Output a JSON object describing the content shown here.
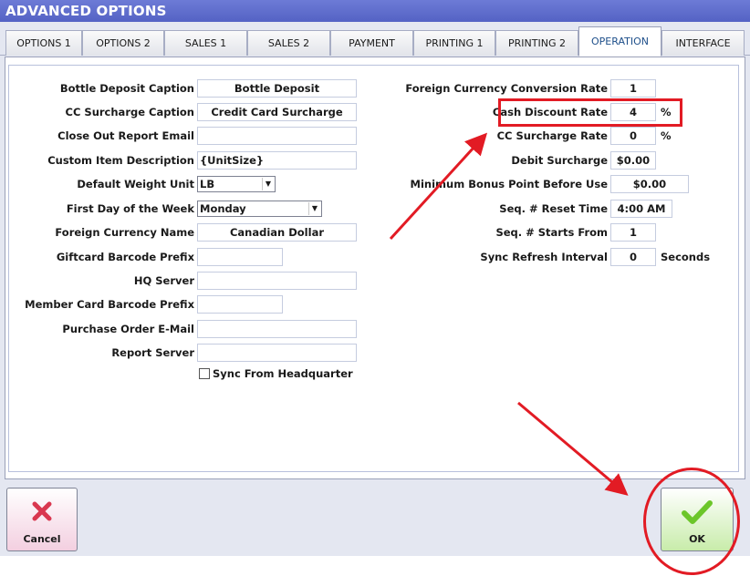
{
  "window": {
    "title": "ADVANCED OPTIONS"
  },
  "tabs": [
    {
      "label": "OPTIONS 1"
    },
    {
      "label": "OPTIONS 2"
    },
    {
      "label": "SALES 1"
    },
    {
      "label": "SALES 2"
    },
    {
      "label": "PAYMENT"
    },
    {
      "label": "PRINTING 1"
    },
    {
      "label": "PRINTING 2"
    },
    {
      "label": "OPERATION",
      "active": true
    },
    {
      "label": "INTERFACE"
    }
  ],
  "left_fields": {
    "bottle_deposit_caption": {
      "label": "Bottle Deposit Caption",
      "value": "Bottle Deposit"
    },
    "cc_surcharge_caption": {
      "label": "CC Surcharge Caption",
      "value": "Credit Card Surcharge"
    },
    "close_out_report_email": {
      "label": "Close Out Report Email",
      "value": ""
    },
    "custom_item_description": {
      "label": "Custom Item Description",
      "value": "{UnitSize}"
    },
    "default_weight_unit": {
      "label": "Default Weight Unit",
      "value": "LB"
    },
    "first_day_of_week": {
      "label": "First Day of the Week",
      "value": "Monday"
    },
    "foreign_currency_name": {
      "label": "Foreign Currency Name",
      "value": "Canadian Dollar"
    },
    "giftcard_barcode_prefix": {
      "label": "Giftcard Barcode Prefix",
      "value": ""
    },
    "hq_server": {
      "label": "HQ Server",
      "value": ""
    },
    "member_card_barcode_prefix": {
      "label": "Member Card Barcode Prefix",
      "value": ""
    },
    "purchase_order_email": {
      "label": "Purchase Order E-Mail",
      "value": ""
    },
    "report_server": {
      "label": "Report Server",
      "value": ""
    },
    "sync_from_headquarter": {
      "label": "Sync From Headquarter",
      "checked": false
    }
  },
  "right_fields": {
    "foreign_currency_conversion_rate": {
      "label": "Foreign Currency Conversion Rate",
      "value": "1"
    },
    "cash_discount_rate": {
      "label": "Cash Discount Rate",
      "value": "4",
      "suffix": "%"
    },
    "cc_surcharge_rate": {
      "label": "CC Surcharge Rate",
      "value": "0",
      "suffix": "%"
    },
    "debit_surcharge": {
      "label": "Debit Surcharge",
      "value": "$0.00"
    },
    "minimum_bonus_point": {
      "label": "Minimum Bonus Point Before Use",
      "value": "$0.00"
    },
    "seq_reset_time": {
      "label": "Seq. # Reset Time",
      "value": "4:00 AM"
    },
    "seq_starts_from": {
      "label": "Seq. # Starts From",
      "value": "1"
    },
    "sync_refresh_interval": {
      "label": "Sync Refresh Interval",
      "value": "0",
      "suffix": "Seconds"
    }
  },
  "buttons": {
    "cancel": {
      "label": "Cancel"
    },
    "ok": {
      "label": "OK"
    }
  },
  "colors": {
    "title_bar": "#5a67c9",
    "annotation_red": "#e21b24",
    "ok_green": "#6cc62a",
    "cancel_red": "#d9374f"
  }
}
